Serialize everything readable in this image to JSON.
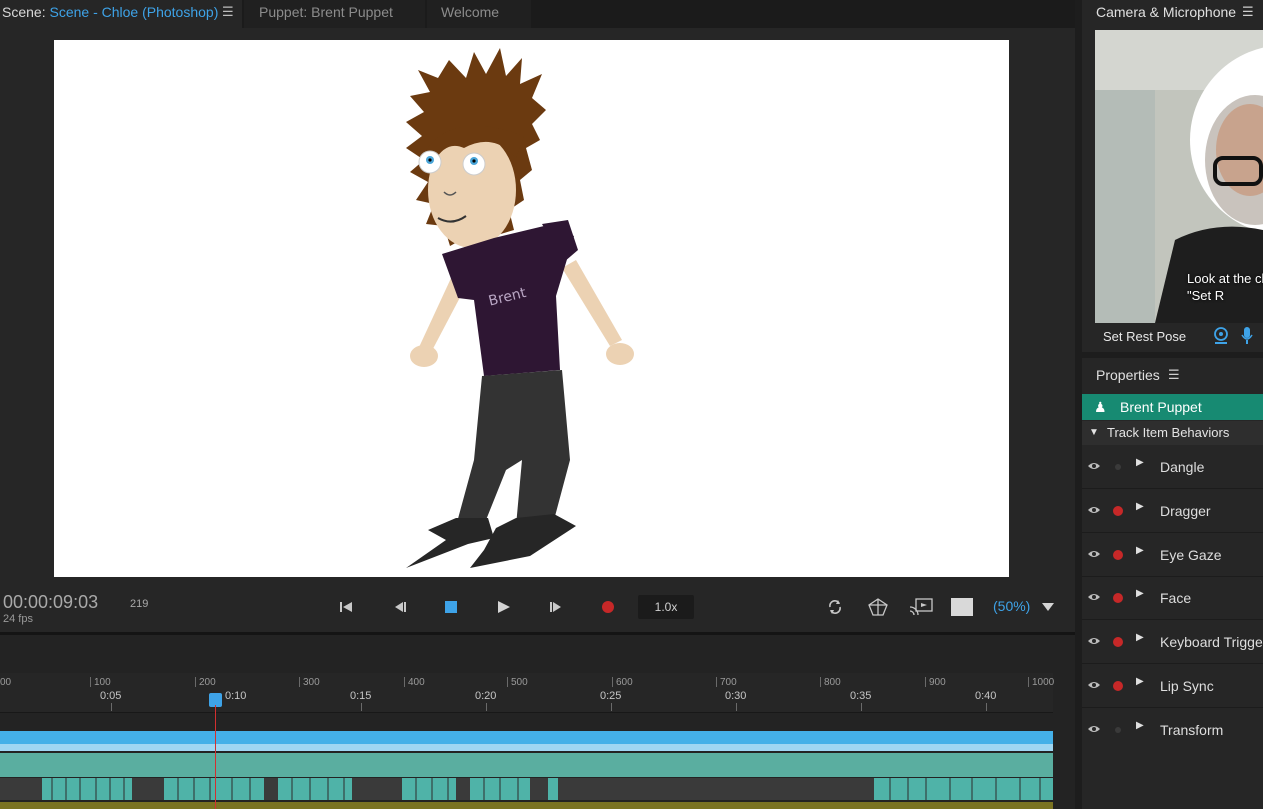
{
  "tabs": {
    "scene_prefix": "Scene:",
    "scene_name": "Scene - Chloe (Photoshop)",
    "puppet": "Puppet: Brent Puppet",
    "welcome": "Welcome"
  },
  "transport": {
    "timecode": "00:00:09:03",
    "fps": "24 fps",
    "frame": "219",
    "speed": "1.0x",
    "zoom": "(50%)"
  },
  "ruler": {
    "frame_labels": [
      "00",
      "100",
      "200",
      "300",
      "400",
      "500",
      "600",
      "700",
      "800",
      "900",
      "1000"
    ],
    "time_labels": [
      "0:05",
      "0:10",
      "0:15",
      "0:20",
      "0:25",
      "0:30",
      "0:35",
      "0:40"
    ]
  },
  "camera": {
    "title": "Camera & Microphone",
    "hint": "Look at the click the \"Set R",
    "set_rest_label": "Set Rest Pose"
  },
  "properties": {
    "title": "Properties",
    "puppet_name": "Brent Puppet",
    "section_label": "Track Item Behaviors",
    "behaviors": [
      {
        "label": "Dangle",
        "armed": false
      },
      {
        "label": "Dragger",
        "armed": true
      },
      {
        "label": "Eye Gaze",
        "armed": true
      },
      {
        "label": "Face",
        "armed": true
      },
      {
        "label": "Keyboard Triggers",
        "armed": true
      },
      {
        "label": "Lip Sync",
        "armed": true
      },
      {
        "label": "Transform",
        "armed": false
      }
    ]
  },
  "colors": {
    "accent_blue": "#3ea3e8",
    "puppet_row_teal": "#178a72",
    "record_red": "#c62828"
  }
}
